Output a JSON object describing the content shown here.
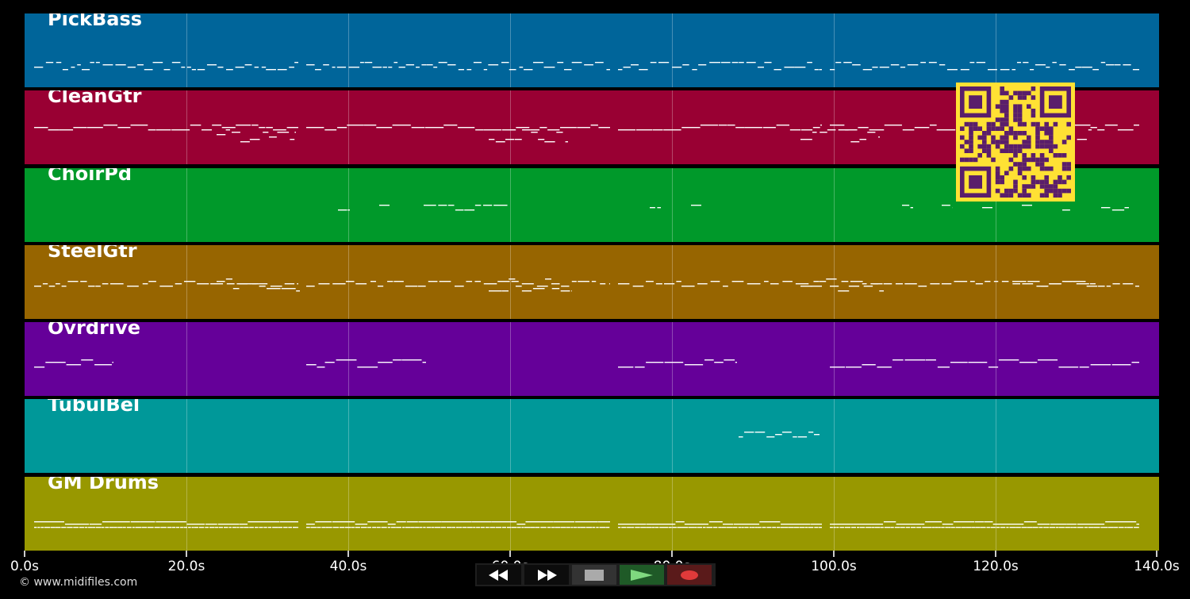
{
  "tracks": [
    {
      "name": "PickBass",
      "color": "#00659a"
    },
    {
      "name": "CleanGtr",
      "color": "#990033"
    },
    {
      "name": "ChoirPd",
      "color": "#00992a"
    },
    {
      "name": "SteelGtr",
      "color": "#976500"
    },
    {
      "name": "Ovrdrive",
      "color": "#650099"
    },
    {
      "name": "TubulBel",
      "color": "#009899"
    },
    {
      "name": "GM Drums",
      "color": "#989800"
    }
  ],
  "axis": {
    "ticks": [
      "0.0s",
      "20.0s",
      "40.0s",
      "60.0s",
      "80.0s",
      "100.0s",
      "120.0s",
      "140.0s"
    ]
  },
  "copyright": "© www.midifiles.com",
  "transport": {
    "buttons": [
      "rewind-icon",
      "fast-forward-icon",
      "stop-icon",
      "play-icon",
      "record-icon"
    ]
  },
  "qr": {
    "icon": "qr-code-icon",
    "fg": "#5a1e6b",
    "bg": "#ffe134"
  }
}
